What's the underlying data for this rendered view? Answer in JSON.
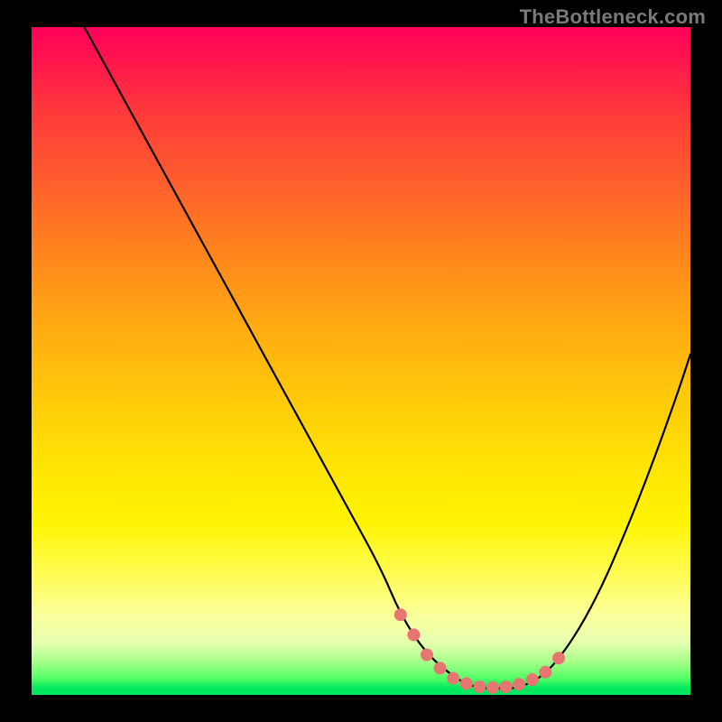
{
  "watermark": {
    "text": "TheBottleneck.com"
  },
  "colors": {
    "background": "#000000",
    "curve": "#000000",
    "marker": "#e77570",
    "gradient_top": "#ff005a",
    "gradient_mid": "#ffe205",
    "gradient_bottom": "#00e85e"
  },
  "chart_data": {
    "type": "line",
    "title": "",
    "xlabel": "",
    "ylabel": "",
    "xlim": [
      0,
      100
    ],
    "ylim": [
      0,
      100
    ],
    "grid": false,
    "legend": false,
    "series": [
      {
        "name": "bottleneck-curve",
        "x": [
          8,
          13,
          18,
          23,
          28,
          33,
          38,
          43,
          48,
          53,
          56,
          60,
          65,
          68,
          71,
          74,
          78,
          82,
          86,
          90,
          94,
          98,
          100
        ],
        "values": [
          100,
          91,
          82,
          73,
          64,
          55,
          46,
          37,
          28,
          19,
          12,
          6,
          2,
          1,
          1,
          1,
          3,
          8,
          15,
          24,
          34,
          45,
          51
        ]
      }
    ],
    "markers": {
      "name": "highlight-zone",
      "x": [
        56,
        58,
        60,
        62,
        64,
        66,
        68,
        70,
        72,
        74,
        76,
        78,
        80
      ],
      "values": [
        12,
        9,
        6,
        4,
        2.5,
        1.7,
        1.2,
        1.1,
        1.2,
        1.6,
        2.3,
        3.4,
        5.5
      ]
    }
  }
}
